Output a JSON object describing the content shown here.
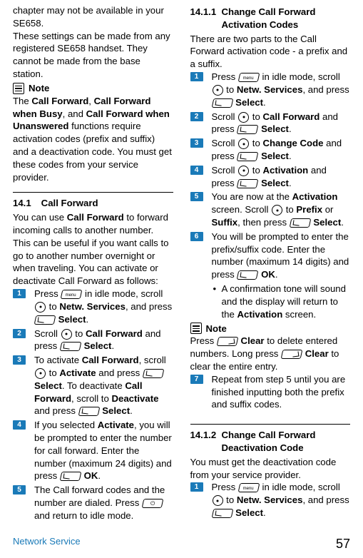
{
  "col1": {
    "intro1": "chapter may not be available in your SE658.",
    "intro2": "These settings can be made from any registered SE658 handset. They cannot be made from the base station.",
    "noteLabel": "Note",
    "noteBody": {
      "pre": "The ",
      "b1": "Call Forward",
      "mid1": ", ",
      "b2": "Call Forward when Busy",
      "mid2": ", and ",
      "b3": "Call Forward when Unanswered",
      "post": " functions require activation codes (prefix and suffix) and a deactivation code. You must get these codes from your service provider."
    },
    "secNum": "14.1",
    "secTitle": "Call Forward",
    "secIntro": {
      "pre": "You can use ",
      "b": "Call Forward",
      "post": " to forward incoming calls to another number. This can be useful if you want calls to go to another number overnight or when traveling. You can activate or deactivate Call Forward as follows:"
    },
    "netwServices": "Netw. Services",
    "select": "Select",
    "steps": {
      "s1": {
        "a": "Press ",
        "b": " in idle mode, scroll ",
        "c": " to ",
        "d": ", and press "
      },
      "s2": {
        "a": "Scroll ",
        "b": " to ",
        "bold": "Call Forward",
        "c": " and press ",
        "d": ".",
        "sel": "Select"
      },
      "s3": {
        "a": "To activate ",
        "b1": "Call Forward",
        "b": ", scroll ",
        "c": " to ",
        "act": "Activate",
        "d": " and press ",
        "sel": "Select",
        "e": ". To deactivate ",
        "b2": "Call Forward",
        "f": ", scroll to ",
        "deact": "Deactivate",
        "g": " and press ",
        "sel2": "Select",
        "h": "."
      },
      "s4": {
        "a": "If you selected ",
        "act": "Activate",
        "b": ", you will be prompted to enter the number for call forward. Enter the number (maximum 24 digits) and press ",
        "ok": "OK",
        "c": "."
      },
      "s5": {
        "a": "The Call forward codes and the number are dialed. Press ",
        "b": " and return to idle mode."
      }
    }
  },
  "col2": {
    "sub1Num": "14.1.1",
    "sub1Title": "Change Call Forward Activation Codes",
    "intro": "There are two parts to the Call Forward activation code - a prefix and a suffix.",
    "netwServices": "Netw. Services",
    "select": "Select",
    "steps1": {
      "s1": {
        "a": "Press ",
        "b": " in idle mode, scroll ",
        "c": " to ",
        "d": ", and press ",
        "e": "."
      },
      "s2": {
        "a": "Scroll ",
        "b": " to ",
        "bold": "Call Forward",
        "c": " and press ",
        "sel": "Select",
        "d": "."
      },
      "s3": {
        "a": "Scroll ",
        "b": " to ",
        "bold": "Change Code",
        "c": " and press ",
        "sel": "Select",
        "d": "."
      },
      "s4": {
        "a": "Scroll ",
        "b": " to ",
        "bold": "Activation",
        "c": " and press ",
        "sel": "Select",
        "d": "."
      },
      "s5": {
        "a": "You are now at the ",
        "bold": "Activation",
        "b": " screen. Scroll ",
        "c": " to ",
        "p": "Prefix",
        "d": " or ",
        "s": "Suffix",
        "e": ", then press ",
        "sel": "Select",
        "f": "."
      },
      "s6": {
        "a": "You will be prompted to enter the prefix/suffix code. Enter the number (maximum 14 digits) and press ",
        "ok": "OK",
        "b": "."
      },
      "bullet": {
        "a": "A confirmation tone will sound and the display will return to the ",
        "bold": "Activation",
        "b": " screen."
      }
    },
    "noteLabel": "Note",
    "noteBody": {
      "a": "Press ",
      "c1": "Clear",
      "b": " to delete entered numbers. Long press ",
      "c2": "Clear",
      "c": " to clear the entire entry."
    },
    "steps1b": {
      "s7": "Repeat from step 5 until you are finished inputting both the prefix and suffix codes."
    },
    "sub2Num": "14.1.2",
    "sub2Title": "Change Call Forward Deactivation Code",
    "intro2": "You must get the deactivation code from your service provider.",
    "steps2": {
      "s1": {
        "a": "Press ",
        "b": " in idle mode, scroll ",
        "c": " to ",
        "d": ", and press ",
        "e": "."
      }
    }
  },
  "footer": {
    "left": "Network Service",
    "right": "57"
  }
}
